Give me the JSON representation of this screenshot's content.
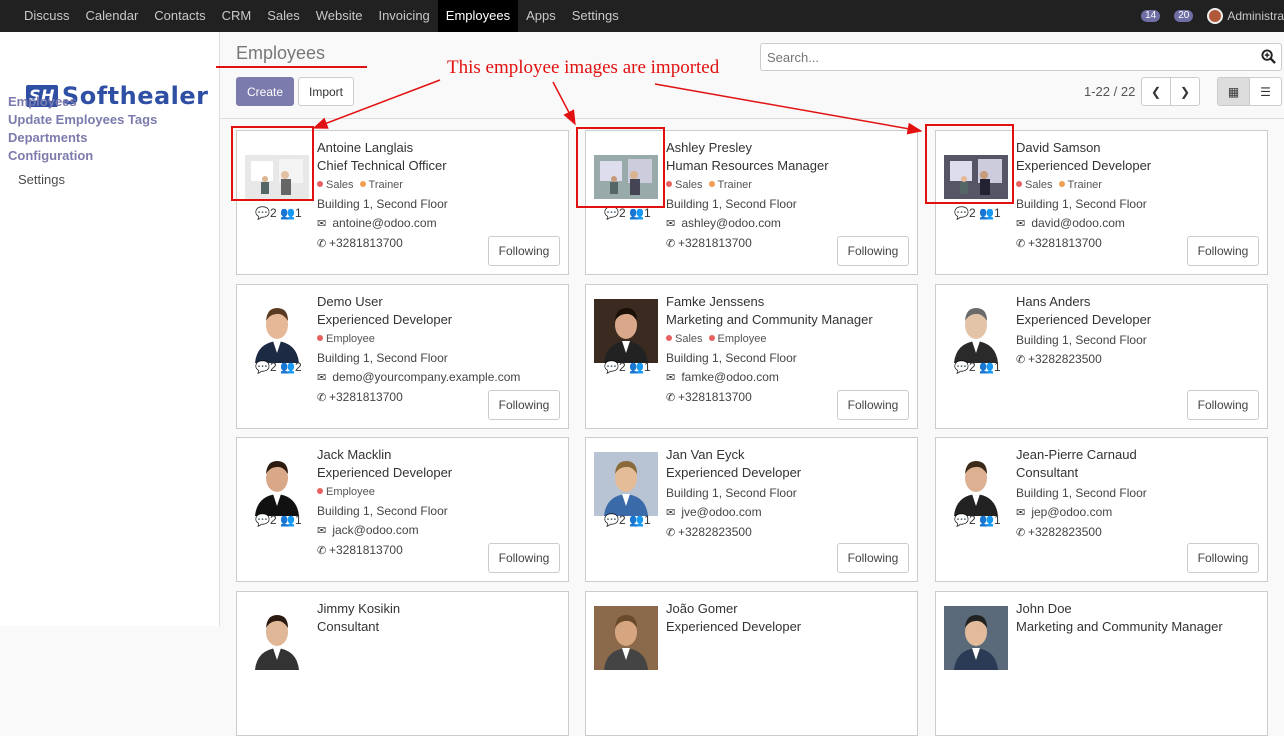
{
  "topbar": {
    "menu": [
      "Discuss",
      "Calendar",
      "Contacts",
      "CRM",
      "Sales",
      "Website",
      "Invoicing",
      "Employees",
      "Apps",
      "Settings"
    ],
    "active": "Employees",
    "messages_count": "14",
    "activities_count": "20",
    "user": "Administrator"
  },
  "logo": {
    "mark": "SH",
    "text": "Softhealer"
  },
  "sidebar": {
    "items": [
      "Employees",
      "Update Employees Tags",
      "Departments",
      "Configuration"
    ],
    "sub": "Settings"
  },
  "page": {
    "title": "Employees"
  },
  "search": {
    "placeholder": "Search..."
  },
  "buttons": {
    "create": "Create",
    "import": "Import"
  },
  "pager": {
    "text": "1-22 / 22"
  },
  "annotation": {
    "text": "This employee images are imported",
    "color": "#e21111"
  },
  "employees": [
    {
      "name": "Antoine Langlais",
      "job": "Chief Technical Officer",
      "tags": [
        [
          "Sales",
          "red"
        ],
        [
          "Trainer",
          "orange"
        ]
      ],
      "location": "Building 1, Second Floor",
      "email": "antoine@odoo.com",
      "phone": "+3281813700",
      "msgs": "2",
      "followers": "1",
      "follow_label": "Following"
    },
    {
      "name": "Ashley Presley",
      "job": "Human Resources Manager",
      "tags": [
        [
          "Sales",
          "red"
        ],
        [
          "Trainer",
          "orange"
        ]
      ],
      "location": "Building 1, Second Floor",
      "email": "ashley@odoo.com",
      "phone": "+3281813700",
      "msgs": "2",
      "followers": "1",
      "follow_label": "Following"
    },
    {
      "name": "David Samson",
      "job": "Experienced Developer",
      "tags": [
        [
          "Sales",
          "red"
        ],
        [
          "Trainer",
          "orange"
        ]
      ],
      "location": "Building 1, Second Floor",
      "email": "david@odoo.com",
      "phone": "+3281813700",
      "msgs": "2",
      "followers": "1",
      "follow_label": "Following"
    },
    {
      "name": "Demo User",
      "job": "Experienced Developer",
      "tags": [
        [
          "Employee",
          "red"
        ]
      ],
      "location": "Building 1, Second Floor",
      "email": "demo@yourcompany.example.com",
      "phone": "+3281813700",
      "msgs": "2",
      "followers": "2",
      "follow_label": "Following"
    },
    {
      "name": "Famke Jenssens",
      "job": "Marketing and Community Manager",
      "tags": [
        [
          "Sales",
          "red"
        ],
        [
          "Employee",
          "red"
        ]
      ],
      "location": "Building 1, Second Floor",
      "email": "famke@odoo.com",
      "phone": "+3281813700",
      "msgs": "2",
      "followers": "1",
      "follow_label": "Following"
    },
    {
      "name": "Hans Anders",
      "job": "Experienced Developer",
      "tags": [],
      "location": "Building 1, Second Floor",
      "email": "",
      "phone": "+3282823500",
      "msgs": "2",
      "followers": "1",
      "follow_label": "Following"
    },
    {
      "name": "Jack Macklin",
      "job": "Experienced Developer",
      "tags": [
        [
          "Employee",
          "red"
        ]
      ],
      "location": "Building 1, Second Floor",
      "email": "jack@odoo.com",
      "phone": "+3281813700",
      "msgs": "2",
      "followers": "1",
      "follow_label": "Following"
    },
    {
      "name": "Jan Van Eyck",
      "job": "Experienced Developer",
      "tags": [],
      "location": "Building 1, Second Floor",
      "email": "jve@odoo.com",
      "phone": "+3282823500",
      "msgs": "2",
      "followers": "1",
      "follow_label": "Following"
    },
    {
      "name": "Jean-Pierre Carnaud",
      "job": "Consultant",
      "tags": [],
      "location": "Building 1, Second Floor",
      "email": "jep@odoo.com",
      "phone": "+3282823500",
      "msgs": "2",
      "followers": "1",
      "follow_label": "Following"
    },
    {
      "name": "Jimmy Kosikin",
      "job": "Consultant",
      "tags": [],
      "location": "",
      "email": "",
      "phone": "",
      "msgs": "",
      "followers": "",
      "follow_label": ""
    },
    {
      "name": "João Gomer",
      "job": "Experienced Developer",
      "tags": [],
      "location": "",
      "email": "",
      "phone": "",
      "msgs": "",
      "followers": "",
      "follow_label": ""
    },
    {
      "name": "John Doe",
      "job": "Marketing and Community Manager",
      "tags": [],
      "location": "",
      "email": "",
      "phone": "",
      "msgs": "",
      "followers": "",
      "follow_label": ""
    }
  ]
}
